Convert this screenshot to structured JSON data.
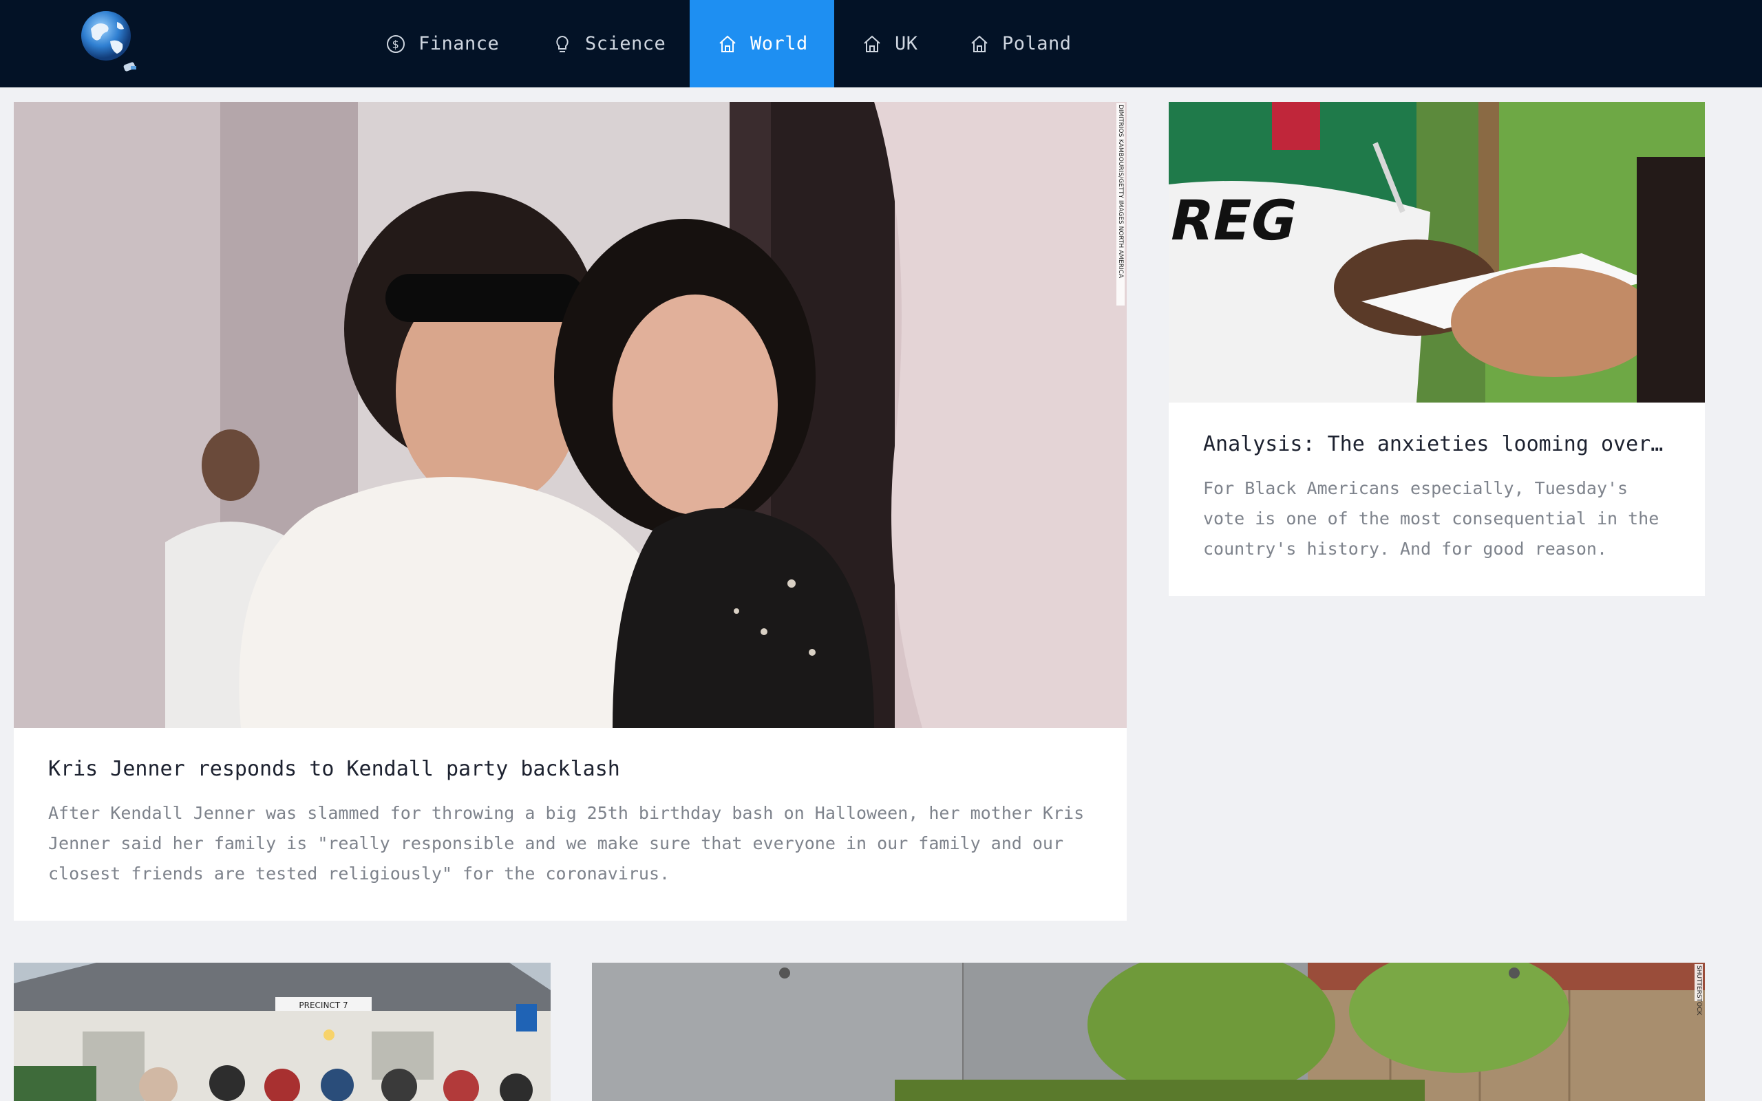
{
  "nav": {
    "logo": "globe-logo",
    "items": [
      {
        "label": "Finance",
        "icon": "dollar-circle-icon",
        "active": false
      },
      {
        "label": "Science",
        "icon": "lightbulb-icon",
        "active": false
      },
      {
        "label": "World",
        "icon": "home-icon",
        "active": true
      },
      {
        "label": "UK",
        "icon": "home-icon",
        "active": false
      },
      {
        "label": "Poland",
        "icon": "home-icon",
        "active": false
      }
    ],
    "active_color": "#1e8ff2",
    "background": "#031226"
  },
  "articles": [
    {
      "title": "Kris Jenner responds to Kendall party backlash",
      "description": "After Kendall Jenner was slammed for throwing a big 25th birthday bash on Halloween, her mother Kris Jenner said her family is \"really responsible and we make sure that everyone in our family and our closest friends are tested religiously\" for the coronavirus.",
      "image_credit": "DIMITRIOS KAMBOURIS/GETTY IMAGES NORTH AMERICA"
    },
    {
      "title": "Analysis: The anxieties looming over ...",
      "description": "For Black Americans especially, Tuesday's vote is one of the most consequential in the country's history. And for good reason."
    },
    {
      "image_sign": "PRECINCT 7"
    },
    {
      "image_credit": "SHUTTERSTOCK"
    }
  ]
}
